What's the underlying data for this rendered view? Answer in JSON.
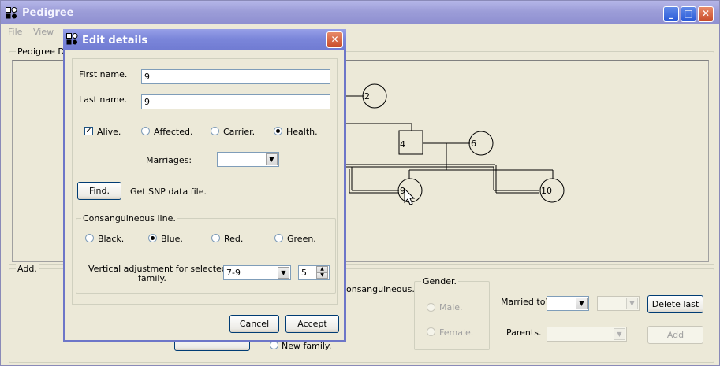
{
  "window": {
    "title": "Pedigree",
    "controls": {
      "minimize": "_",
      "maximize": "□",
      "close": "✕"
    }
  },
  "menu": {
    "file": "File",
    "view": "View"
  },
  "drawing": {
    "group_label": "Pedigree Dr",
    "nodes": [
      {
        "id": "2",
        "shape": "circle"
      },
      {
        "id": "4",
        "shape": "square"
      },
      {
        "id": "6",
        "shape": "circle"
      },
      {
        "id": "9",
        "shape": "circle"
      },
      {
        "id": "10",
        "shape": "circle"
      }
    ]
  },
  "add_panel": {
    "group_label": "Add.",
    "consanguineous_text": "onsanguineous.",
    "new_family": "New family.",
    "gender": {
      "label": "Gender.",
      "male": "Male.",
      "female": "Female."
    },
    "married_to": "Married to?",
    "parents": "Parents.",
    "delete_last": "Delete last",
    "add": "Add"
  },
  "dialog": {
    "title": "Edit details",
    "close": "✕",
    "first_name_label": "First name.",
    "first_name_value": "9",
    "last_name_label": "Last name.",
    "last_name_value": "9",
    "alive": "Alive.",
    "affected": "Affected.",
    "carrier": "Carrier.",
    "health": "Health.",
    "marriages_label": "Marriages:",
    "find_button": "Find.",
    "snp_text": "Get SNP data file.",
    "consang": {
      "group_label": "Consanguineous line.",
      "black": "Black.",
      "blue": "Blue.",
      "red": "Red.",
      "green": "Green."
    },
    "vertical_adjust_label_1": "Vertical adjustment for selected",
    "vertical_adjust_label_2": "family.",
    "family_select": "7-9",
    "spin_value": "5",
    "cancel": "Cancel",
    "accept": "Accept"
  },
  "colors": {
    "title_active": "#707BD2",
    "title_inactive": "#9C9DD8",
    "face": "#ECE9D8",
    "border_blue": "#003C74"
  },
  "icons": {
    "app": "pedigree-app-icon",
    "cursor": "mouse-pointer-icon",
    "dropdown": "chevron-down-icon"
  }
}
